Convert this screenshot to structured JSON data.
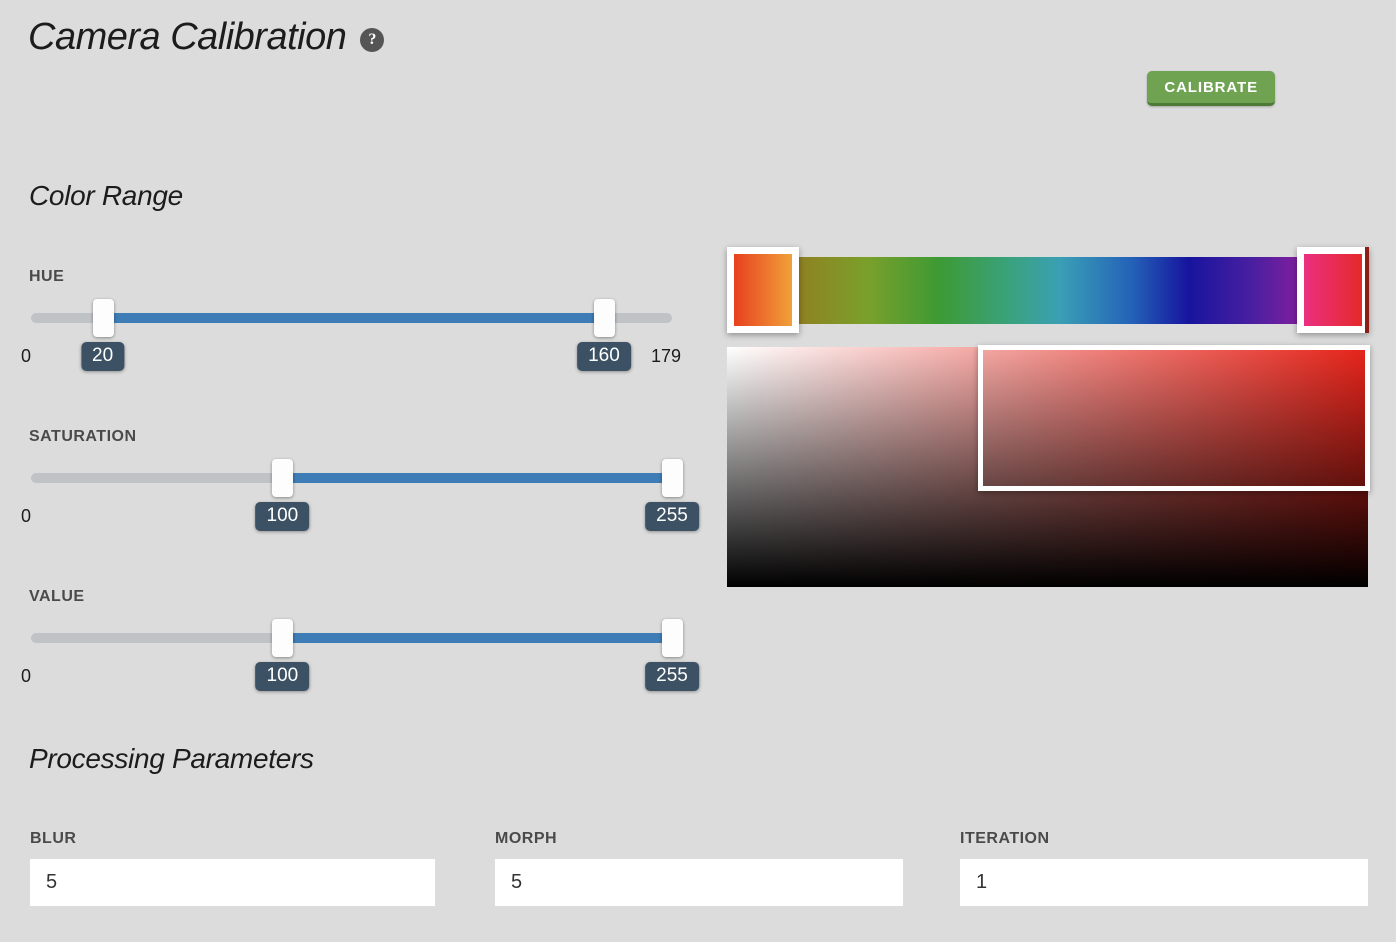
{
  "header": {
    "title": "Camera Calibration",
    "help_icon": "question-mark-circle-icon",
    "help_glyph": "?",
    "calibrate_label": "CALIBRATE",
    "calibrate_color": "#6fa352"
  },
  "sections": {
    "color_range_heading": "Color Range",
    "processing_heading": "Processing Parameters"
  },
  "sliders": [
    {
      "id": "hue",
      "label": "HUE",
      "min": 0,
      "max": 179,
      "min_label": "0",
      "max_label": "179",
      "low": 20,
      "high": 160,
      "low_label": "20",
      "high_label": "160",
      "show_max_label": true
    },
    {
      "id": "saturation",
      "label": "SATURATION",
      "min": 0,
      "max": 255,
      "min_label": "0",
      "max_label": "255",
      "low": 100,
      "high": 255,
      "low_label": "100",
      "high_label": "255",
      "show_max_label": false
    },
    {
      "id": "value",
      "label": "VALUE",
      "min": 0,
      "max": 255,
      "min_label": "0",
      "max_label": "255",
      "low": 100,
      "high": 255,
      "low_label": "100",
      "high_label": "255",
      "show_max_label": false
    }
  ],
  "preview": {
    "hue_bar": {
      "low_swatch_colors": [
        "#e8401f",
        "#f0a13a"
      ],
      "high_swatch_colors": [
        "#ea2f80",
        "#e52a2a"
      ],
      "marker_border": "#ffffff"
    },
    "sv_panel": {
      "base_color": "#e8241a",
      "selection_border": "#ffffff"
    }
  },
  "params": [
    {
      "id": "blur",
      "label": "BLUR",
      "value": "5"
    },
    {
      "id": "morph",
      "label": "MORPH",
      "value": "5"
    },
    {
      "id": "iteration",
      "label": "ITERATION",
      "value": "1"
    }
  ],
  "colors": {
    "background": "#dcdcdc",
    "slider_fill": "#3d7cb5",
    "slider_track": "#bfc3c6",
    "badge": "#3c5164"
  }
}
